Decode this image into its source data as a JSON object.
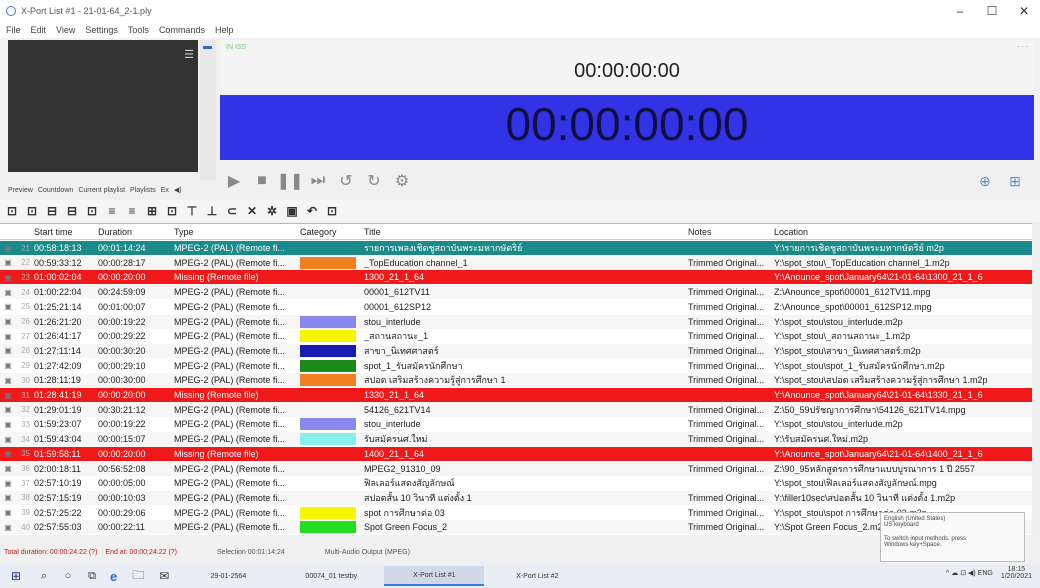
{
  "window": {
    "title": "X-Port List #1 - 21-01-64_2-1.ply",
    "min": "–",
    "max": "☐",
    "close": "✕"
  },
  "menu": [
    "File",
    "Edit",
    "View",
    "Settings",
    "Tools",
    "Commands",
    "Help"
  ],
  "clocks": {
    "small": "00:00:00:00",
    "big": "00:00:00:00",
    "left_label": "IN ISS",
    "right_label": "- - -"
  },
  "left_tabs": [
    "Preview",
    "Countdown",
    "Current playlist",
    "Playlists",
    "Ex",
    "◀)"
  ],
  "transport": [
    "▶",
    "■",
    "❚❚",
    "⏭",
    "↺",
    "↻",
    "⚙"
  ],
  "transport_right": [
    "⊕",
    "⊞"
  ],
  "toolbar_icons": [
    "⊡",
    "⊡",
    "⊟",
    "⊟",
    "⊡",
    "≡",
    "≡",
    "⊞",
    "⊡",
    "⊤",
    "⊥",
    "⊂",
    "✕",
    "✲",
    "▣",
    "↶",
    "⊡"
  ],
  "columns": {
    "start": "Start time",
    "duration": "Duration",
    "type": "Type",
    "category": "Category",
    "title": "Title",
    "notes": "Notes",
    "location": "Location"
  },
  "rows": [
    {
      "idx": "21",
      "start": "00:58:18:13",
      "duration": "00:01:14:24",
      "type": "MPEG-2 (PAL) (Remote fi...",
      "cat": "",
      "title": "รายการเพลงเชิดชูสถาบันพระมหากษัตริย์",
      "notes": "",
      "location": "Y:\\รายการเชิดชูสถาบันพระมหากษัตริย์ m2p"
    },
    {
      "idx": "22",
      "start": "00:59:33:12",
      "duration": "00:00:28:17",
      "type": "MPEG-2 (PAL) (Remote fi...",
      "cat": "#f08020",
      "title": "_TopEducation channel_1",
      "notes": "Trimmed Original...",
      "location": "Y:\\spot_stou\\_TopEducation channel_1.m2p"
    },
    {
      "idx": "23",
      "start": "01:00:02:04",
      "duration": "00:00:20:00",
      "type": "Missing (Remote file)",
      "cat": "",
      "title": "1300_21_1_64",
      "notes": "",
      "location": "Y:\\Anounce_spot\\January64\\21-01-64\\1300_21_1_6"
    },
    {
      "idx": "24",
      "start": "01:00:22:04",
      "duration": "00:24:59:09",
      "type": "MPEG-2 (PAL) (Remote fi...",
      "cat": "",
      "title": "00001_612TV11",
      "notes": "Trimmed Original...",
      "location": "Z:\\Anounce_spot\\00001_612TV11.mpg"
    },
    {
      "idx": "25",
      "start": "01:25:21:14",
      "duration": "00:01:00:07",
      "type": "MPEG-2 (PAL) (Remote fi...",
      "cat": "",
      "title": "00001_612SP12",
      "notes": "Trimmed Original...",
      "location": "Z:\\Anounce_spot\\00001_612SP12.mpg"
    },
    {
      "idx": "26",
      "start": "01:26:21:20",
      "duration": "00:00:19:22",
      "type": "MPEG-2 (PAL) (Remote fi...",
      "cat": "#8888ee",
      "title": "stou_interlude",
      "notes": "Trimmed Original...",
      "location": "Y:\\spot_stou\\stou_interlude.m2p"
    },
    {
      "idx": "27",
      "start": "01:26:41:17",
      "duration": "00:00:29:22",
      "type": "MPEG-2 (PAL) (Remote fi...",
      "cat": "#f5f500",
      "title": "_สถานสถานะ_1",
      "notes": "Trimmed Original...",
      "location": "Y:\\spot_stou\\_สถานสถานะ_1.m2p"
    },
    {
      "idx": "28",
      "start": "01:27:11:14",
      "duration": "00:00:30:20",
      "type": "MPEG-2 (PAL) (Remote fi...",
      "cat": "#1a1ab0",
      "title": "สาขา_นิเทศศาสตร์",
      "notes": "Trimmed Original...",
      "location": "Y:\\spot_stou\\สาขา_นิเทศศาสตร์.m2p"
    },
    {
      "idx": "29",
      "start": "01:27:42:09",
      "duration": "00:00:29:10",
      "type": "MPEG-2 (PAL) (Remote fi...",
      "cat": "#1a8a1a",
      "title": "spot_1_รับสมัครนักศึกษา",
      "notes": "Trimmed Original...",
      "location": "Y:\\spot_stou\\spot_1_รับสมัครนักศึกษา.m2p"
    },
    {
      "idx": "30",
      "start": "01:28:11:19",
      "duration": "00:00:30:00",
      "type": "MPEG-2 (PAL) (Remote fi...",
      "cat": "#f08020",
      "title": "สปอต เสริมสร้างความรู้สู่การศึกษา 1",
      "notes": "Trimmed Original...",
      "location": "Y:\\spot_stou\\สปอต เสริมสร้างความรู้สู่การศึกษา 1.m2p"
    },
    {
      "idx": "31",
      "start": "01:28:41:19",
      "duration": "00:00:20:00",
      "type": "Missing (Remote file)",
      "cat": "",
      "title": "1330_21_1_64",
      "notes": "",
      "location": "Y:\\Anounce_spot\\January64\\21-01-64\\1330_21_1_6"
    },
    {
      "idx": "32",
      "start": "01:29:01:19",
      "duration": "00:30:21:12",
      "type": "MPEG-2 (PAL) (Remote fi...",
      "cat": "",
      "title": "54126_621TV14",
      "notes": "Trimmed Original...",
      "location": "Z:\\50_59ปรัชญาการศึกษา\\54126_621TV14.mpg"
    },
    {
      "idx": "33",
      "start": "01:59:23:07",
      "duration": "00:00:19:22",
      "type": "MPEG-2 (PAL) (Remote fi...",
      "cat": "#8888ee",
      "title": "stou_interlude",
      "notes": "Trimmed Original...",
      "location": "Y:\\spot_stou\\stou_interlude.m2p"
    },
    {
      "idx": "34",
      "start": "01:59:43:04",
      "duration": "00:00:15:07",
      "type": "MPEG-2 (PAL) (Remote fi...",
      "cat": "#88eeee",
      "title": "รับสมัครนศ.ใหม่",
      "notes": "Trimmed Original...",
      "location": "Y:\\รับสมัครนศ.ใหม่.m2p"
    },
    {
      "idx": "35",
      "start": "01:59:58:11",
      "duration": "00:00:20:00",
      "type": "Missing (Remote file)",
      "cat": "",
      "title": "1400_21_1_64",
      "notes": "",
      "location": "Y:\\Anounce_spot\\January64\\21-01-64\\1400_21_1_6"
    },
    {
      "idx": "36",
      "start": "02:00:18:11",
      "duration": "00:56:52:08",
      "type": "MPEG-2 (PAL) (Remote fi...",
      "cat": "",
      "title": "MPEG2_91310_09",
      "notes": "Trimmed Original...",
      "location": "Z:\\90_95หลักสูตรการศึกษาแบบบูรณาการ 1 ปี 2557"
    },
    {
      "idx": "37",
      "start": "02:57:10:19",
      "duration": "00:00:05:00",
      "type": "MPEG-2 (PAL) (Remote fi...",
      "cat": "",
      "title": "ฟิลเลอร์แสดงสัญลักษณ์",
      "notes": "",
      "location": "Y:\\spot_stou\\ฟิลเลอร์แสดงสัญลักษณ์.mpg"
    },
    {
      "idx": "38",
      "start": "02:57:15:19",
      "duration": "00:00:10:03",
      "type": "MPEG-2 (PAL) (Remote fi...",
      "cat": "",
      "title": "สปอตสั้น 10 วินาที แต่งตั้ง 1",
      "notes": "Trimmed Original...",
      "location": "Y:\\filler10sec\\สปอตสั้น 10 วินาที แต่งตั้ง 1.m2p"
    },
    {
      "idx": "39",
      "start": "02:57:25:22",
      "duration": "00:00:29:06",
      "type": "MPEG-2 (PAL) (Remote fi...",
      "cat": "#f5f500",
      "title": "spot การศึกษาต่อ 03",
      "notes": "Trimmed Original...",
      "location": "Y:\\spot_stou\\spot การศึกษาต่อ 03.m2p"
    },
    {
      "idx": "40",
      "start": "02:57:55:03",
      "duration": "00:00:22:11",
      "type": "MPEG-2 (PAL) (Remote fi...",
      "cat": "#22dd22",
      "title": "Spot Green Focus_2",
      "notes": "Trimmed Original...",
      "location": "Y:\\Spot Green Focus_2.m2p"
    }
  ],
  "status": {
    "total": "Total duration: 00:00:24:22 (?)",
    "end": "End at: 00:00:24:22 (?)",
    "selection": "Selection 00:01:14:24",
    "multi": "Multi-Audio Output (MPEG)"
  },
  "tooltip": {
    "line1": "English (United States)",
    "line2": "US keyboard",
    "line3": "To switch input methods, press",
    "line4": "Windows key+Space."
  },
  "taskbar": {
    "start": "⊞",
    "search": "⌕",
    "cortana": "○",
    "taskview": "⧉",
    "apps": [
      "e",
      "🗀",
      "✉",
      "29-01-2564",
      "00074_01 testby",
      "X-Port List #1",
      "X-Port List #2"
    ],
    "tray": "^ ☁ ⊡ ◀) ENG",
    "time": "18:15",
    "date": "1/20/2021"
  }
}
